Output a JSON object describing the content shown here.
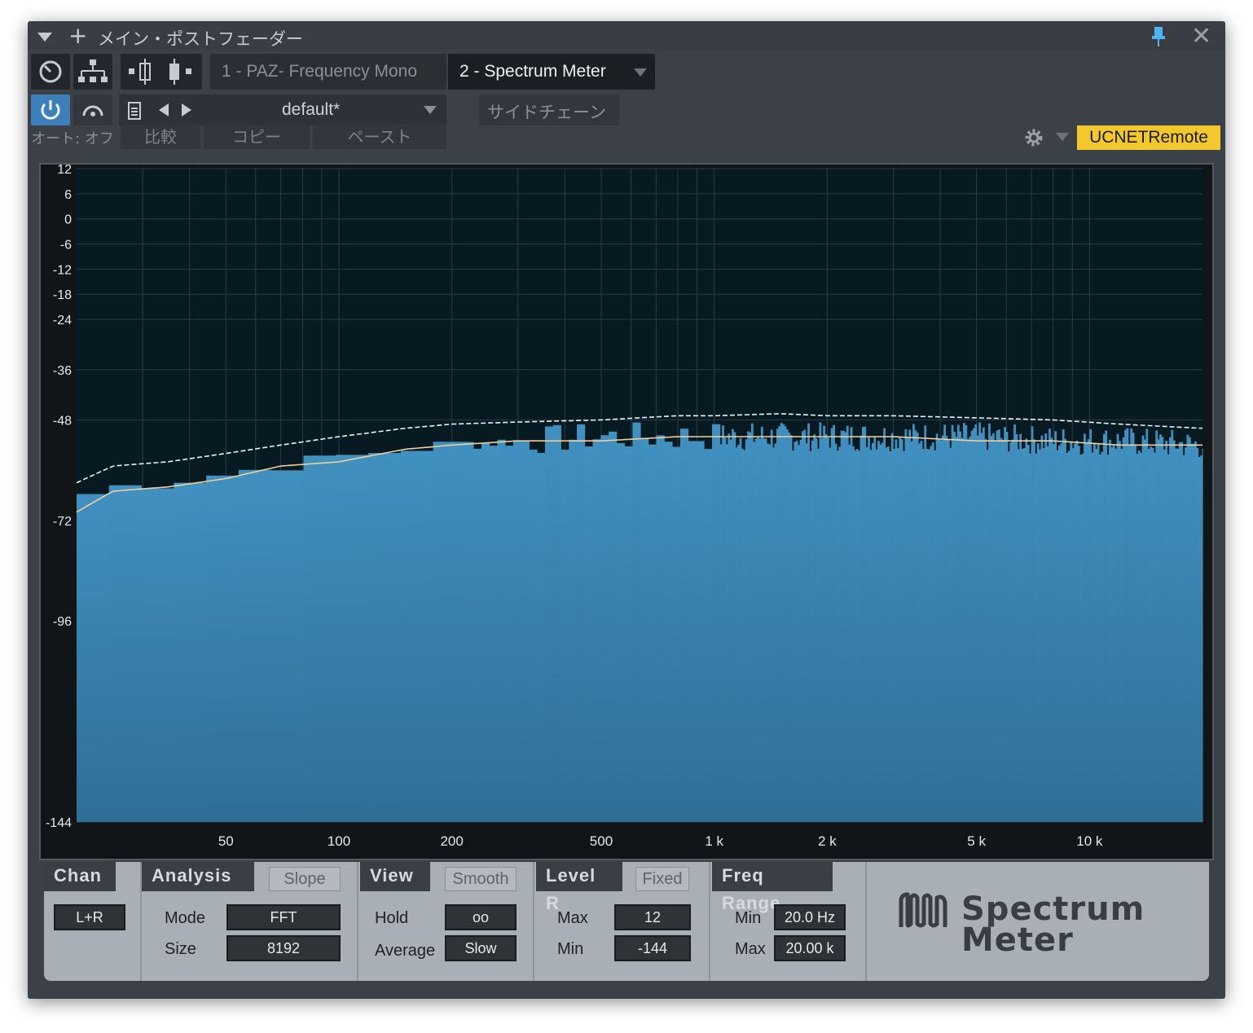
{
  "window": {
    "title": "メイン・ポストフェーダー"
  },
  "toolbar": {
    "tabs": [
      "1 - PAZ- Frequency Mono",
      "2 - Spectrum Meter"
    ],
    "preset": "default*",
    "sidechain": "サイドチェーン",
    "auto": "オート: オフ",
    "compare": "比較",
    "copy": "コピー",
    "paste": "ペースト",
    "remote": "UCNETRemote",
    "remote_color": "#f3c82c"
  },
  "chart_data": {
    "type": "bar",
    "x_scale": "log",
    "x_range_hz": [
      20,
      20000
    ],
    "y_range_db": [
      -144,
      12
    ],
    "y_ticks": [
      "12",
      "6",
      "0",
      "-6",
      "-12",
      "-18",
      "-24",
      "-36",
      "-48",
      "-72",
      "-96",
      "-144"
    ],
    "x_ticks": [
      "50",
      "100",
      "200",
      "500",
      "1 k",
      "2 k",
      "5 k",
      "10 k"
    ],
    "grid": true,
    "fill_color": "#4090c0",
    "series": [
      {
        "x_hz": [
          20,
          25,
          35,
          50,
          70,
          100,
          150,
          200,
          300,
          500,
          800,
          1000,
          1500,
          2000,
          3000,
          5000,
          8000,
          12000,
          20000
        ],
        "values": [
          -67,
          -64,
          -63,
          -61,
          -59,
          -57,
          -55,
          -54,
          -53,
          -52,
          -52,
          -52,
          -52,
          -52,
          -52,
          -52,
          -53,
          -53,
          -54
        ]
      },
      {
        "x_hz": [
          20,
          25,
          35,
          50,
          70,
          100,
          150,
          200,
          300,
          500,
          800,
          1000,
          1500,
          2000,
          3000,
          5000,
          8000,
          12000,
          20000
        ],
        "values": [
          -63,
          -59,
          -58,
          -56,
          -54,
          -52,
          -50,
          -49,
          -48.5,
          -48,
          -47,
          -47,
          -46.5,
          -47,
          -47,
          -47.5,
          -48,
          -49,
          -50
        ]
      },
      {
        "x_hz": [
          20,
          25,
          35,
          50,
          70,
          100,
          150,
          200,
          300,
          500,
          800,
          1000,
          1500,
          2000,
          3000,
          5000,
          8000,
          12000,
          20000
        ],
        "values": [
          -70,
          -65,
          -64,
          -62,
          -59,
          -58,
          -55,
          -54,
          -53,
          -53,
          -52,
          -52,
          -52,
          -52,
          -52,
          -53,
          -53,
          -54,
          -54
        ]
      }
    ]
  },
  "controls": {
    "chan": {
      "head": "Chan",
      "value": "L+R"
    },
    "analysis": {
      "head": "Analysis",
      "opt": "Slope",
      "mode_label": "Mode",
      "mode": "FFT",
      "size_label": "Size",
      "size": "8192"
    },
    "view": {
      "head": "View",
      "opt": "Smooth",
      "hold_label": "Hold",
      "hold": "oo",
      "average_label": "Average",
      "average": "Slow"
    },
    "level": {
      "head": "Level R",
      "opt": "Fixed",
      "max_label": "Max",
      "max": "12",
      "min_label": "Min",
      "min": "-144"
    },
    "freq": {
      "head": "Freq Range",
      "min_label": "Min",
      "min": "20.0 Hz",
      "max_label": "Max",
      "max": "20.00 k"
    },
    "logo": [
      "Spectrum",
      "Meter"
    ]
  }
}
